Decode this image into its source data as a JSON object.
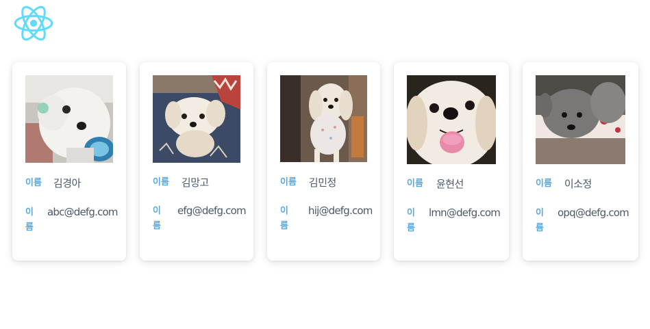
{
  "app": {
    "logo_icon": "react-logo-icon",
    "logo_color": "#61dafb"
  },
  "colors": {
    "label": "#5aa7e0",
    "value": "#4a5868",
    "card_bg": "#ffffff"
  },
  "cards": [
    {
      "name_label": "이름",
      "name": "김경아",
      "email_label": "이름",
      "email": "abc@defg.com"
    },
    {
      "name_label": "이름",
      "name": "김망고",
      "email_label": "이름",
      "email": "efg@defg.com"
    },
    {
      "name_label": "이름",
      "name": "김민정",
      "email_label": "이름",
      "email": "hij@defg.com"
    },
    {
      "name_label": "이름",
      "name": "윤현선",
      "email_label": "이름",
      "email": "lmn@defg.com"
    },
    {
      "name_label": "이름",
      "name": "이소정",
      "email_label": "이름",
      "email": "opq@defg.com"
    }
  ]
}
